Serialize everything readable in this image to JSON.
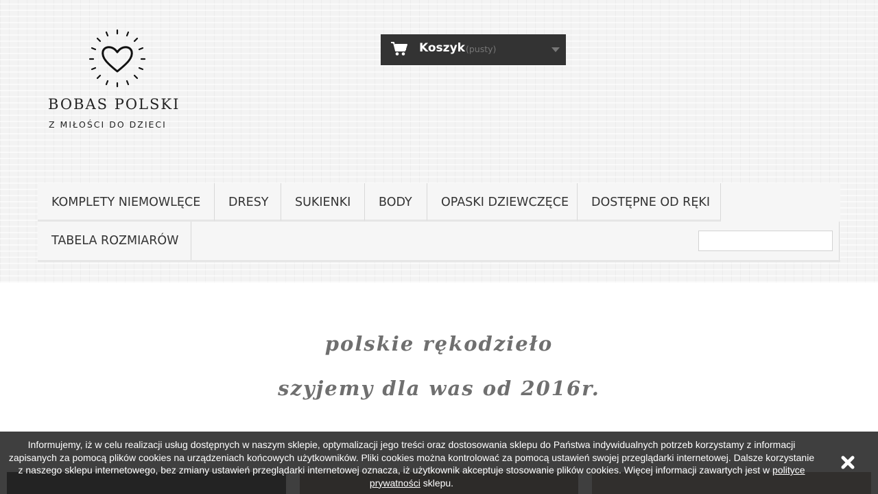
{
  "logo": {
    "title": "BOBAS POLSKI",
    "subtitle": "Z MIŁOŚCI DO DZIECI",
    "icon": "heart-sun-icon"
  },
  "cart": {
    "label": "Koszyk",
    "status": "(pusty)",
    "icon": "shopping-cart-icon"
  },
  "menu": {
    "items": [
      "KOMPLETY NIEMOWLĘCE",
      "DRESY",
      "SUKIENKI",
      "BODY",
      "OPASKI DZIEWCZĘCE",
      "DOSTĘPNE OD RĘKI",
      "TABELA ROZMIARÓW"
    ]
  },
  "search": {
    "value": "",
    "placeholder": ""
  },
  "tagline": {
    "line1": "polskie rękodzieło",
    "line2": "szyjemy dla was od 2016r."
  },
  "cookie": {
    "text": "Informujemy, iż w celu realizacji usług dostępnych w naszym sklepie, optymalizacji jego treści oraz dostosowania sklepu do Państwa indywidualnych potrzeb korzystamy z informacji zapisanych za pomocą plików cookies na urządzeniach końcowych użytkowników. Pliki cookies można kontrolować za pomocą ustawień swojej przeglądarki internetowej. Dalsze korzystanie z naszego sklepu internetowego, bez zmiany ustawień przeglądarki internetowej oznacza, iż użytkownik akceptuje stosowanie plików cookies. Więcej informacji zawartych jest w ",
    "link": "polityce prywatności",
    "suffix": " sklepu.",
    "close_icon": "close-icon"
  },
  "colors": {
    "cart_bg": "#333333",
    "menu_bg": "#f6f6f6",
    "tagline": "#6f6f6f",
    "cookie_bg": "#242424"
  }
}
